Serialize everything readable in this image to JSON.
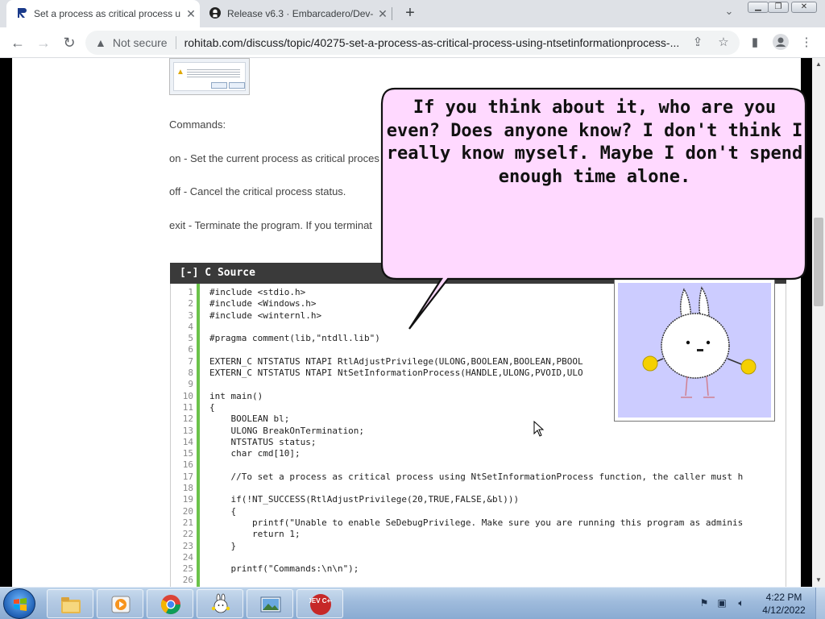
{
  "browser": {
    "tabs": [
      {
        "title": "Set a process as critical process u",
        "favicon": "rohitab-icon",
        "active": true
      },
      {
        "title": "Release v6.3 · Embarcadero/Dev-",
        "favicon": "github-icon",
        "active": false
      }
    ],
    "new_tab_label": "+",
    "address": {
      "security_label": "Not secure",
      "url": "rohitab.com/discuss/topic/40275-set-a-process-as-critical-process-using-ntsetinformationprocess-..."
    },
    "window_controls": [
      "minimize",
      "maximize",
      "close"
    ]
  },
  "page": {
    "commands_heading": "Commands:",
    "paragraphs": [
      "on - Set the current process as critical proces",
      "off - Cancel the critical process status.",
      "exit - Terminate the program. If you terminat"
    ],
    "code_box": {
      "header": "[-] C Source",
      "lines": [
        {
          "n": "1",
          "text": "#include <stdio.h>"
        },
        {
          "n": "2",
          "text": "#include <Windows.h>"
        },
        {
          "n": "3",
          "text": "#include <winternl.h>"
        },
        {
          "n": "4",
          "text": ""
        },
        {
          "n": "5",
          "text": "#pragma comment(lib,\"ntdll.lib\")"
        },
        {
          "n": "6",
          "text": ""
        },
        {
          "n": "7",
          "text": "EXTERN_C NTSTATUS NTAPI RtlAdjustPrivilege(ULONG,BOOLEAN,BOOLEAN,PBOOL"
        },
        {
          "n": "8",
          "text": "EXTERN_C NTSTATUS NTAPI NtSetInformationProcess(HANDLE,ULONG,PVOID,ULO"
        },
        {
          "n": "9",
          "text": ""
        },
        {
          "n": "10",
          "text": "int main()"
        },
        {
          "n": "11",
          "text": "{"
        },
        {
          "n": "12",
          "text": "    BOOLEAN bl;"
        },
        {
          "n": "13",
          "text": "    ULONG BreakOnTermination;"
        },
        {
          "n": "14",
          "text": "    NTSTATUS status;"
        },
        {
          "n": "15",
          "text": "    char cmd[10];"
        },
        {
          "n": "16",
          "text": ""
        },
        {
          "n": "17",
          "text": "    //To set a process as critical process using NtSetInformationProcess function, the caller must h"
        },
        {
          "n": "18",
          "text": ""
        },
        {
          "n": "19",
          "text": "    if(!NT_SUCCESS(RtlAdjustPrivilege(20,TRUE,FALSE,&bl)))"
        },
        {
          "n": "20",
          "text": "    {"
        },
        {
          "n": "21",
          "text": "        printf(\"Unable to enable SeDebugPrivilege. Make sure you are running this program as adminis"
        },
        {
          "n": "22",
          "text": "        return 1;"
        },
        {
          "n": "23",
          "text": "    }"
        },
        {
          "n": "24",
          "text": ""
        },
        {
          "n": "25",
          "text": "    printf(\"Commands:\\n\\n\");"
        },
        {
          "n": "26",
          "text": ""
        }
      ]
    }
  },
  "overlay": {
    "speech_bubble_text": "If you think about it, who are you even? Does anyone know? I don't think I really know myself. Maybe I don't spend enough time alone.",
    "character": "bunny"
  },
  "taskbar": {
    "pinned": [
      {
        "name": "explorer",
        "icon": "folder-icon"
      },
      {
        "name": "media-player",
        "icon": "media-player-icon"
      },
      {
        "name": "chrome",
        "icon": "chrome-icon"
      },
      {
        "name": "bunny-app",
        "icon": "bunny-icon"
      },
      {
        "name": "image-viewer",
        "icon": "picture-icon"
      },
      {
        "name": "dev-cpp",
        "icon": "dev-cpp-icon",
        "label": "DEV C++"
      }
    ],
    "clock": {
      "time": "4:22 PM",
      "date": "4/12/2022"
    }
  },
  "colors": {
    "code_gutter_bar": "#6bc24a",
    "code_header_bg": "#3a3a3a",
    "bubble_fill": "#ffd9ff",
    "bunny_bg": "#ccccff"
  }
}
